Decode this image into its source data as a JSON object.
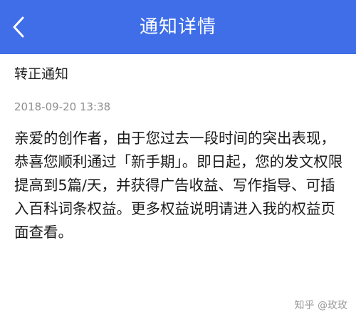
{
  "header": {
    "title": "通知详情",
    "back_icon": "chevron-left-icon",
    "background_color": "#3F6EE8"
  },
  "notice": {
    "title": "转正通知",
    "timestamp": "2018-09-20 13:38",
    "body": "亲爱的创作者，由于您过去一段时间的突出表现，恭喜您顺利通过「新手期」。即日起，您的发文权限提高到5篇/天，并获得广告收益、写作指导、可插入百科词条权益。更多权益说明请进入我的权益页面查看。"
  },
  "watermark": {
    "text": "知乎 @玫玫"
  }
}
